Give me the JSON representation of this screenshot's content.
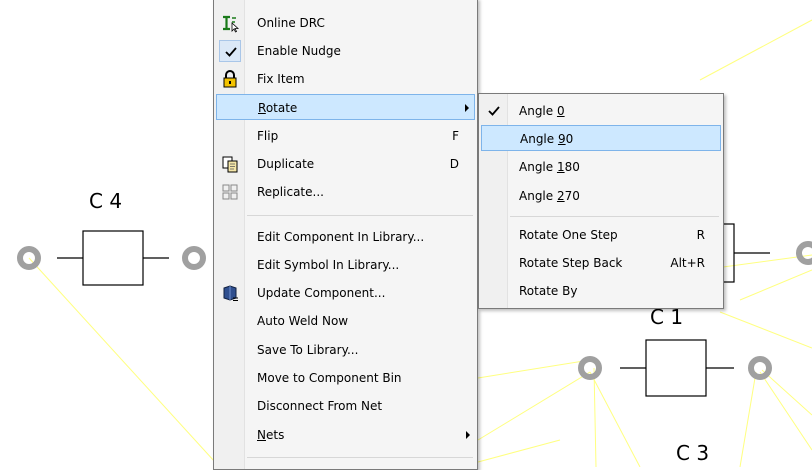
{
  "context_menu": {
    "items": [
      {
        "label": "Online DRC",
        "icon": "online-drc-icon"
      },
      {
        "label": "Enable Nudge",
        "icon": "checkmark-icon"
      },
      {
        "label": "Fix Item",
        "icon": "lock-icon"
      },
      {
        "label": "Rotate",
        "accel": "R",
        "highlighted": true,
        "submenu": true
      },
      {
        "label": "Flip",
        "shortcut": "F"
      },
      {
        "label": "Duplicate",
        "shortcut": "D",
        "icon": "duplicate-icon"
      },
      {
        "label": "Replicate...",
        "icon": "replicate-icon"
      },
      {
        "label": "Edit Component In Library..."
      },
      {
        "label": "Edit Symbol In Library..."
      },
      {
        "label": "Update Component...",
        "icon": "update-component-icon"
      },
      {
        "label": "Auto Weld Now"
      },
      {
        "label": "Save To Library..."
      },
      {
        "label": "Move to Component Bin"
      },
      {
        "label": "Disconnect From Net"
      },
      {
        "label": "Nets",
        "accel": "N",
        "submenu": true
      }
    ]
  },
  "rotate_submenu": {
    "items": [
      {
        "pre": "Angle ",
        "accel": "0",
        "post": "",
        "checked": true
      },
      {
        "pre": "Angle ",
        "accel": "9",
        "post": "0",
        "highlighted": true
      },
      {
        "pre": "Angle ",
        "accel": "1",
        "post": "80"
      },
      {
        "pre": "Angle ",
        "accel": "2",
        "post": "70"
      },
      {
        "pre": "Rotate One Step",
        "shortcut": "R"
      },
      {
        "pre": "Rotate Step Back",
        "shortcut": "Alt+R"
      },
      {
        "pre": "Rotate By"
      }
    ]
  },
  "schematic": {
    "labels": {
      "c4": "C 4",
      "c1": "C 1",
      "c3": "C 3"
    },
    "colors": {
      "wire": "#ffff80",
      "pad": "#a0a0a0",
      "body": "#000000"
    }
  }
}
